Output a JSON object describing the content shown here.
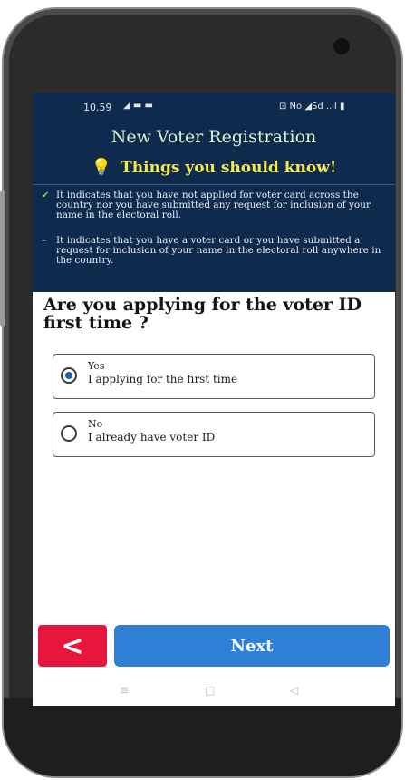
{
  "status_bar": {
    "time": "10.59",
    "left_icons": "◢ ▬ ▬",
    "right_icons": "⊡ No ◢Sd ..ıl ▮"
  },
  "header": {
    "title": "New Voter Registration",
    "things_heading": "Things you should know!",
    "notes": [
      "It indicates that you have not applied for voter card across the country nor you have submitted any request for inclusion of your name in the electoral roll.",
      "It indicates that you have a voter card or you have submitted a request for inclusion of your name in the electoral roll anywhere in the country."
    ]
  },
  "question": "Are you applying for the voter ID first time ?",
  "options": [
    {
      "label": "Yes",
      "sublabel": "I applying for the first time",
      "selected": true
    },
    {
      "label": "No",
      "sublabel": "I already have voter ID",
      "selected": false
    }
  ],
  "buttons": {
    "back_glyph": "<",
    "next_label": "Next"
  },
  "nav": {
    "menu_glyph": "≡",
    "home_glyph": "□",
    "back_glyph": "◁"
  },
  "colors": {
    "header_bg": "#0e2a4d",
    "back_button": "#e8163c",
    "next_button": "#2f7fd6",
    "heading_yellow": "#f2e94b"
  }
}
